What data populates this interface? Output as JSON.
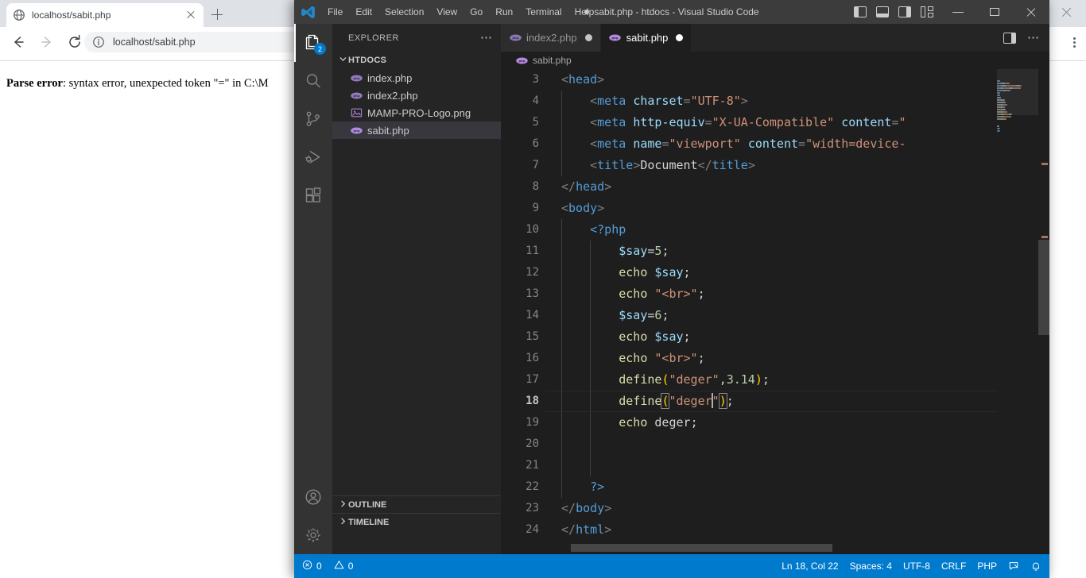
{
  "browser": {
    "tab": {
      "title": "localhost/sabit.php",
      "favicon_icon": "globe-icon",
      "close_icon": "close-icon"
    },
    "new_tab_icon": "plus-icon",
    "nav": {
      "back_icon": "arrow-back-icon",
      "forward_icon": "arrow-forward-icon",
      "reload_icon": "reload-icon"
    },
    "omnibox": {
      "info_icon": "info-circle-icon",
      "value": "localhost/sabit.php"
    },
    "menu_icon": "kebab-menu-icon",
    "window_close_icon": "close-icon",
    "page": {
      "error_label": "Parse error",
      "error_rest": ": syntax error, unexpected token \"=\" in C:\\M"
    }
  },
  "vscode": {
    "titlebar": {
      "logo_icon": "vscode-logo-icon",
      "menus": [
        "File",
        "Edit",
        "Selection",
        "View",
        "Go",
        "Run",
        "Terminal",
        "Help"
      ],
      "title": "sabit.php - htdocs - Visual Studio Code",
      "dirty_indicator": "●",
      "layout_controls": [
        {
          "name": "toggle-primary-sidebar-icon"
        },
        {
          "name": "toggle-panel-icon"
        },
        {
          "name": "toggle-secondary-sidebar-icon"
        },
        {
          "name": "customize-layout-icon"
        }
      ],
      "window_controls": [
        {
          "name": "minimize-button",
          "icon": "minimize-icon"
        },
        {
          "name": "maximize-button",
          "icon": "maximize-icon"
        },
        {
          "name": "close-button",
          "icon": "close-icon"
        }
      ]
    },
    "activity_bar": {
      "items": [
        {
          "name": "explorer",
          "icon": "files-icon",
          "active": true,
          "badge": "2"
        },
        {
          "name": "search",
          "icon": "search-icon",
          "active": false,
          "badge": ""
        },
        {
          "name": "source-control",
          "icon": "source-control-icon",
          "active": false,
          "badge": ""
        },
        {
          "name": "run-and-debug",
          "icon": "run-debug-icon",
          "active": false,
          "badge": ""
        },
        {
          "name": "extensions",
          "icon": "extensions-icon",
          "active": false,
          "badge": ""
        }
      ],
      "bottom": [
        {
          "name": "accounts",
          "icon": "account-icon"
        },
        {
          "name": "manage",
          "icon": "gear-icon"
        }
      ]
    },
    "sidebar": {
      "header": {
        "title": "EXPLORER",
        "more_actions_icon": "ellipsis-icon"
      },
      "folder": {
        "label": "HTDOCS",
        "chevron": "⌄",
        "expanded": true
      },
      "files": [
        {
          "label": "index.php",
          "icon": "php-file-icon",
          "selected": false
        },
        {
          "label": "index2.php",
          "icon": "php-file-icon",
          "selected": false
        },
        {
          "label": "MAMP-PRO-Logo.png",
          "icon": "image-file-icon",
          "selected": false
        },
        {
          "label": "sabit.php",
          "icon": "php-file-icon",
          "selected": true
        }
      ],
      "panels": [
        {
          "label": "OUTLINE",
          "chevron": "›"
        },
        {
          "label": "TIMELINE",
          "chevron": "›"
        }
      ]
    },
    "editor": {
      "tabs": [
        {
          "label": "index2.php",
          "icon": "php-file-icon",
          "active": false,
          "dirty": true
        },
        {
          "label": "sabit.php",
          "icon": "php-file-icon",
          "active": true,
          "dirty": true
        }
      ],
      "tab_actions": [
        {
          "name": "split-editor-icon"
        },
        {
          "name": "more-actions-icon"
        }
      ],
      "breadcrumb": {
        "icon": "php-file-icon",
        "label": "sabit.php"
      },
      "lines": [
        {
          "n": "3",
          "current": false,
          "indent_guides": [],
          "tokens": [
            {
              "t": "<",
              "c": "t-punct"
            },
            {
              "t": "head",
              "c": "t-tag"
            },
            {
              "t": ">",
              "c": "t-punct"
            }
          ]
        },
        {
          "n": "4",
          "current": false,
          "indent_guides": [
            76
          ],
          "tokens": [
            {
              "t": "    ",
              "c": "t-text"
            },
            {
              "t": "<",
              "c": "t-punct"
            },
            {
              "t": "meta",
              "c": "t-tag"
            },
            {
              "t": " ",
              "c": "t-text"
            },
            {
              "t": "charset",
              "c": "t-attr"
            },
            {
              "t": "=",
              "c": "t-punct"
            },
            {
              "t": "\"UTF-8\"",
              "c": "t-str"
            },
            {
              "t": ">",
              "c": "t-punct"
            }
          ]
        },
        {
          "n": "5",
          "current": false,
          "indent_guides": [
            76
          ],
          "tokens": [
            {
              "t": "    ",
              "c": "t-text"
            },
            {
              "t": "<",
              "c": "t-punct"
            },
            {
              "t": "meta",
              "c": "t-tag"
            },
            {
              "t": " ",
              "c": "t-text"
            },
            {
              "t": "http-equiv",
              "c": "t-attr"
            },
            {
              "t": "=",
              "c": "t-punct"
            },
            {
              "t": "\"X-UA-Compatible\"",
              "c": "t-str"
            },
            {
              "t": " ",
              "c": "t-text"
            },
            {
              "t": "content",
              "c": "t-attr"
            },
            {
              "t": "=",
              "c": "t-punct"
            },
            {
              "t": "\"",
              "c": "t-str"
            }
          ]
        },
        {
          "n": "6",
          "current": false,
          "indent_guides": [
            76
          ],
          "tokens": [
            {
              "t": "    ",
              "c": "t-text"
            },
            {
              "t": "<",
              "c": "t-punct"
            },
            {
              "t": "meta",
              "c": "t-tag"
            },
            {
              "t": " ",
              "c": "t-text"
            },
            {
              "t": "name",
              "c": "t-attr"
            },
            {
              "t": "=",
              "c": "t-punct"
            },
            {
              "t": "\"viewport\"",
              "c": "t-str"
            },
            {
              "t": " ",
              "c": "t-text"
            },
            {
              "t": "content",
              "c": "t-attr"
            },
            {
              "t": "=",
              "c": "t-punct"
            },
            {
              "t": "\"width=device-",
              "c": "t-str"
            }
          ]
        },
        {
          "n": "7",
          "current": false,
          "indent_guides": [
            76
          ],
          "tokens": [
            {
              "t": "    ",
              "c": "t-text"
            },
            {
              "t": "<",
              "c": "t-punct"
            },
            {
              "t": "title",
              "c": "t-tag"
            },
            {
              "t": ">",
              "c": "t-punct"
            },
            {
              "t": "Document",
              "c": "t-text"
            },
            {
              "t": "</",
              "c": "t-punct"
            },
            {
              "t": "title",
              "c": "t-tag"
            },
            {
              "t": ">",
              "c": "t-punct"
            }
          ]
        },
        {
          "n": "8",
          "current": false,
          "indent_guides": [],
          "tokens": [
            {
              "t": "</",
              "c": "t-punct"
            },
            {
              "t": "head",
              "c": "t-tag"
            },
            {
              "t": ">",
              "c": "t-punct"
            }
          ]
        },
        {
          "n": "9",
          "current": false,
          "indent_guides": [],
          "tokens": [
            {
              "t": "<",
              "c": "t-punct"
            },
            {
              "t": "body",
              "c": "t-tag"
            },
            {
              "t": ">",
              "c": "t-punct"
            }
          ]
        },
        {
          "n": "10",
          "current": false,
          "indent_guides": [
            76
          ],
          "tokens": [
            {
              "t": "    ",
              "c": "t-text"
            },
            {
              "t": "<?php",
              "c": "t-php"
            }
          ]
        },
        {
          "n": "11",
          "current": false,
          "indent_guides": [
            76,
            112
          ],
          "tokens": [
            {
              "t": "        ",
              "c": "t-text"
            },
            {
              "t": "$say",
              "c": "t-var"
            },
            {
              "t": "=",
              "c": "t-op"
            },
            {
              "t": "5",
              "c": "t-num"
            },
            {
              "t": ";",
              "c": "t-op"
            }
          ]
        },
        {
          "n": "12",
          "current": false,
          "indent_guides": [
            76,
            112
          ],
          "tokens": [
            {
              "t": "        ",
              "c": "t-text"
            },
            {
              "t": "echo",
              "c": "t-kw"
            },
            {
              "t": " ",
              "c": "t-text"
            },
            {
              "t": "$say",
              "c": "t-var"
            },
            {
              "t": ";",
              "c": "t-op"
            }
          ]
        },
        {
          "n": "13",
          "current": false,
          "indent_guides": [
            76,
            112
          ],
          "tokens": [
            {
              "t": "        ",
              "c": "t-text"
            },
            {
              "t": "echo",
              "c": "t-kw"
            },
            {
              "t": " ",
              "c": "t-text"
            },
            {
              "t": "\"<br>\"",
              "c": "t-str"
            },
            {
              "t": ";",
              "c": "t-op"
            }
          ]
        },
        {
          "n": "14",
          "current": false,
          "indent_guides": [
            76,
            112
          ],
          "tokens": [
            {
              "t": "        ",
              "c": "t-text"
            },
            {
              "t": "$say",
              "c": "t-var"
            },
            {
              "t": "=",
              "c": "t-op"
            },
            {
              "t": "6",
              "c": "t-num"
            },
            {
              "t": ";",
              "c": "t-op"
            }
          ]
        },
        {
          "n": "15",
          "current": false,
          "indent_guides": [
            76,
            112
          ],
          "tokens": [
            {
              "t": "        ",
              "c": "t-text"
            },
            {
              "t": "echo",
              "c": "t-kw"
            },
            {
              "t": " ",
              "c": "t-text"
            },
            {
              "t": "$say",
              "c": "t-var"
            },
            {
              "t": ";",
              "c": "t-op"
            }
          ]
        },
        {
          "n": "16",
          "current": false,
          "indent_guides": [
            76,
            112
          ],
          "tokens": [
            {
              "t": "        ",
              "c": "t-text"
            },
            {
              "t": "echo",
              "c": "t-kw"
            },
            {
              "t": " ",
              "c": "t-text"
            },
            {
              "t": "\"<br>\"",
              "c": "t-str"
            },
            {
              "t": ";",
              "c": "t-op"
            }
          ]
        },
        {
          "n": "17",
          "current": false,
          "indent_guides": [
            76,
            112
          ],
          "tokens": [
            {
              "t": "        ",
              "c": "t-text"
            },
            {
              "t": "define",
              "c": "t-fn"
            },
            {
              "t": "(",
              "c": "t-paren"
            },
            {
              "t": "\"deger\"",
              "c": "t-str"
            },
            {
              "t": ",",
              "c": "t-op"
            },
            {
              "t": "3.14",
              "c": "t-num"
            },
            {
              "t": ")",
              "c": "t-paren"
            },
            {
              "t": ";",
              "c": "t-op"
            }
          ]
        },
        {
          "n": "18",
          "current": true,
          "indent_guides": [
            76,
            112
          ],
          "tokens": [
            {
              "t": "        ",
              "c": "t-text"
            },
            {
              "t": "define",
              "c": "t-fn"
            },
            {
              "t": "(",
              "c": "t-paren",
              "hl": true
            },
            {
              "t": "\"deger",
              "c": "t-str"
            },
            {
              "t": "|",
              "c": "cursor"
            },
            {
              "t": "\"",
              "c": "t-str"
            },
            {
              "t": ")",
              "c": "t-paren",
              "hl": true
            },
            {
              "t": ";",
              "c": "t-op"
            }
          ]
        },
        {
          "n": "19",
          "current": false,
          "indent_guides": [
            76,
            112
          ],
          "tokens": [
            {
              "t": "        ",
              "c": "t-text"
            },
            {
              "t": "echo",
              "c": "t-kw"
            },
            {
              "t": " ",
              "c": "t-text"
            },
            {
              "t": "deger",
              "c": "t-const"
            },
            {
              "t": ";",
              "c": "t-op"
            }
          ]
        },
        {
          "n": "20",
          "current": false,
          "indent_guides": [
            76,
            112
          ],
          "tokens": []
        },
        {
          "n": "21",
          "current": false,
          "indent_guides": [
            76,
            112
          ],
          "tokens": []
        },
        {
          "n": "22",
          "current": false,
          "indent_guides": [
            76
          ],
          "tokens": [
            {
              "t": "    ",
              "c": "t-text"
            },
            {
              "t": "?>",
              "c": "t-php"
            }
          ]
        },
        {
          "n": "23",
          "current": false,
          "indent_guides": [],
          "tokens": [
            {
              "t": "</",
              "c": "t-punct"
            },
            {
              "t": "body",
              "c": "t-tag"
            },
            {
              "t": ">",
              "c": "t-punct"
            }
          ]
        },
        {
          "n": "24",
          "current": false,
          "indent_guides": [],
          "tokens": [
            {
              "t": "</",
              "c": "t-punct"
            },
            {
              "t": "html",
              "c": "t-tag"
            },
            {
              "t": ">",
              "c": "t-punct"
            }
          ]
        }
      ]
    },
    "status_bar": {
      "errors": {
        "icon": "error-circle-icon",
        "count": "0"
      },
      "warnings": {
        "icon": "warning-triangle-icon",
        "count": "0"
      },
      "cursor_position": "Ln 18, Col 22",
      "indentation": "Spaces: 4",
      "encoding": "UTF-8",
      "eol": "CRLF",
      "language": "PHP",
      "feedback_icon": "feedback-icon",
      "notifications_icon": "bell-icon"
    }
  },
  "colors": {
    "accent": "#007acc",
    "editor_bg": "#1e1e1e",
    "sidebar_bg": "#252526",
    "activitybar_bg": "#333333",
    "titlebar_bg": "#3c3c3c",
    "browser_tabstrip": "#dee1e6",
    "php_icon": "#8892bf"
  }
}
